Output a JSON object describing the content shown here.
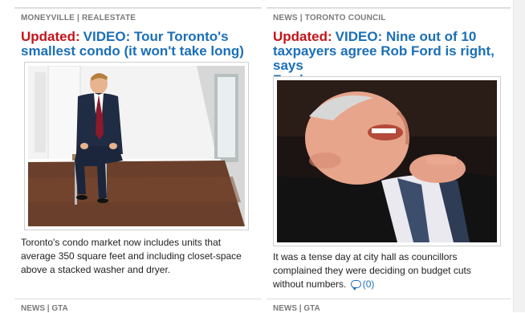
{
  "left_story": {
    "section": "MONEYVILLE | REALESTATE",
    "updated": "Updated:",
    "headline_l1": "VIDEO: Tour Toronto's",
    "headline_l2": "smallest condo (it won't take long)",
    "blurb_l1": "Toronto's condo market now includes units that",
    "blurb_l2": "average 350 square feet and including closet-space",
    "blurb_l3": "above a stacked washer and dryer."
  },
  "right_story": {
    "section": "NEWS | TORONTO COUNCIL",
    "updated": "Updated:",
    "headline_l1": "VIDEO: Nine out of 10",
    "headline_l2": "taxpayers agree Rob Ford is right, says",
    "headline_l3": "Ford",
    "blurb_l1": "It was a tense day at city hall as councillors",
    "blurb_l2": "complained they were deciding on budget cuts",
    "blurb_l3": "without numbers.",
    "comment_count": "(0)"
  },
  "next_row": {
    "left_section": "NEWS | GTA",
    "right_section": "NEWS | GTA"
  },
  "colors": {
    "headline": "#1b6fb7",
    "updated": "#c3141a",
    "section": "#7a7a7a"
  },
  "icons": {
    "comment": "speech-bubble-icon"
  }
}
